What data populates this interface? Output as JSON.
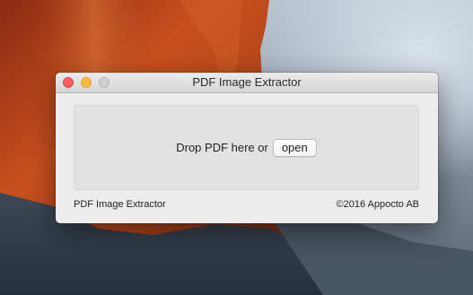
{
  "window": {
    "title": "PDF Image Extractor"
  },
  "dropzone": {
    "prompt": "Drop PDF here or",
    "open_label": "open"
  },
  "footer": {
    "app_name": "PDF Image Extractor",
    "copyright": "©2016 Appocto AB"
  },
  "colors": {
    "close": "#fc605c",
    "minimize": "#fdbc40",
    "zoom_inactive": "#cfcfcf",
    "window_bg": "#ececec",
    "dropzone_bg": "#e2e2e2"
  }
}
